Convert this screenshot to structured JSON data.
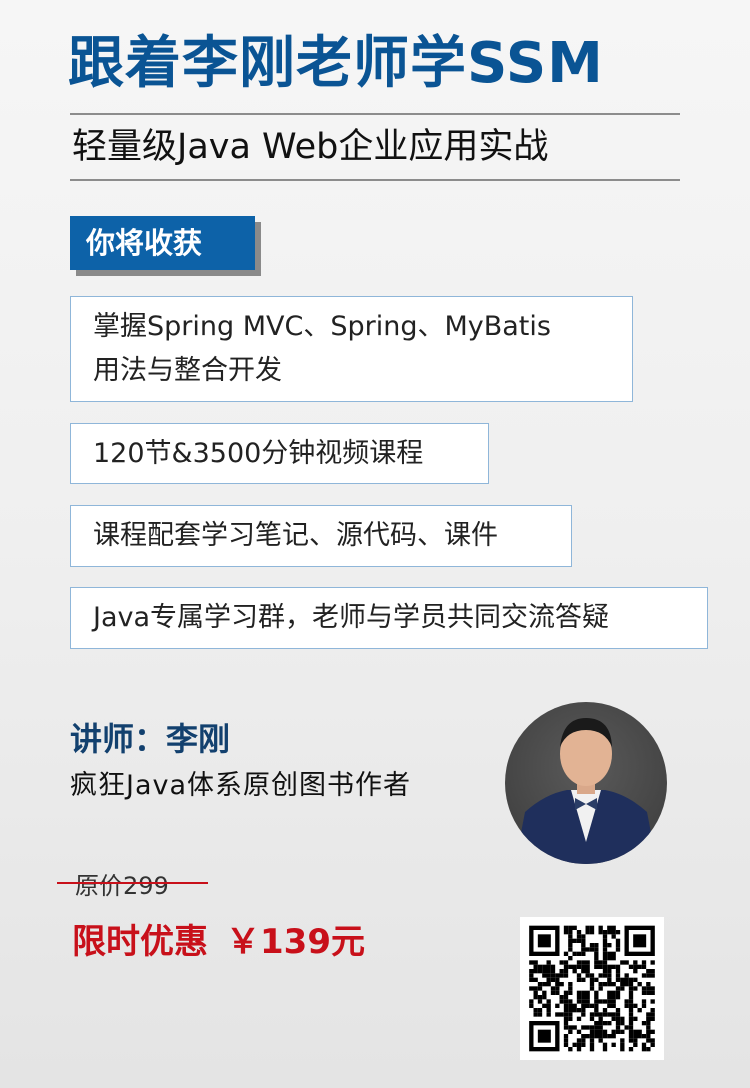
{
  "header": {
    "title": "跟着李刚老师学SSM",
    "subtitle": "轻量级Java Web企业应用实战"
  },
  "benefits": {
    "heading": "你将收获",
    "items": [
      {
        "line1": "掌握Spring MVC、Spring、MyBatis",
        "line2": "用法与整合开发"
      },
      {
        "line1": "120节&3500分钟视频课程"
      },
      {
        "line1": "课程配套学习笔记、源代码、课件"
      },
      {
        "line1": "Java专属学习群，老师与学员共同交流答疑"
      }
    ]
  },
  "instructor": {
    "label": "讲师：李刚",
    "description": "疯狂Java体系原创图书作者"
  },
  "pricing": {
    "original": "原价299",
    "promo_label": "限时优惠",
    "promo_price": "￥139元"
  },
  "colors": {
    "brand_blue": "#0a5494",
    "badge_blue": "#0d62a8",
    "price_red": "#c8101a"
  }
}
